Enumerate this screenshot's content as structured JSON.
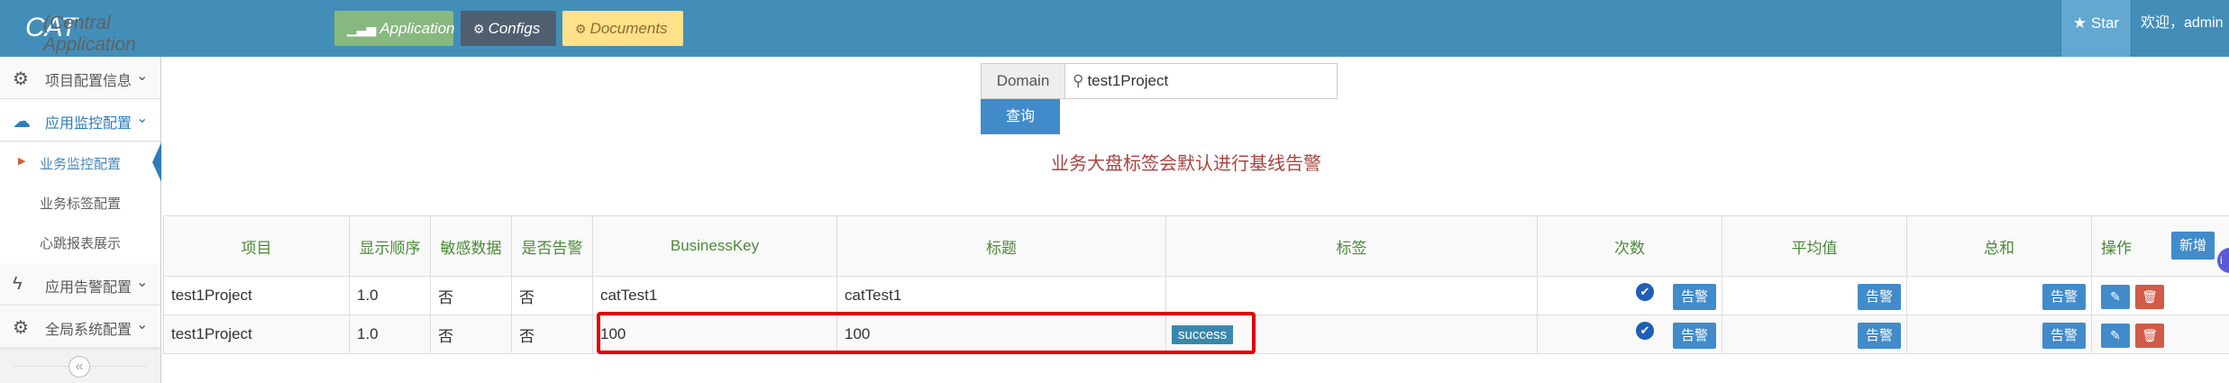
{
  "header": {
    "brand": "CAT",
    "subtitle": "(Central Application Tracking)",
    "buttons": [
      {
        "label": "Application",
        "icon": "signal-icon"
      },
      {
        "label": "Configs",
        "icon": "cogs-icon"
      },
      {
        "label": "Documents",
        "icon": "cogs-icon"
      }
    ],
    "star_label": "Star",
    "welcome": "欢迎，admin"
  },
  "sidebar": {
    "items": [
      {
        "label": "项目配置信息",
        "icon": "cogs-icon"
      },
      {
        "label": "应用监控配置",
        "icon": "cloud-icon"
      },
      {
        "label": "应用告警配置",
        "icon": "bolt-icon"
      },
      {
        "label": "全局系统配置",
        "icon": "gear-icon"
      }
    ],
    "sub_items": [
      {
        "label": "业务监控配置"
      },
      {
        "label": "业务标签配置"
      },
      {
        "label": "心跳报表展示"
      }
    ]
  },
  "search": {
    "domain_label": "Domain",
    "domain_value": "test1Project",
    "query_label": "查询"
  },
  "notice": "业务大盘标签会默认进行基线告警",
  "table": {
    "headers": [
      "项目",
      "显示顺序",
      "敏感数据",
      "是否告警",
      "BusinessKey",
      "标题",
      "标签",
      "次数",
      "平均值",
      "总和",
      "操作"
    ],
    "add_label": "新增",
    "warn_label": "告警",
    "rows": [
      {
        "project": "test1Project",
        "order": "1.0",
        "sensitive": "否",
        "alarm": "否",
        "key": "catTest1",
        "title": "catTest1",
        "tag": ""
      },
      {
        "project": "test1Project",
        "order": "1.0",
        "sensitive": "否",
        "alarm": "否",
        "key": "100",
        "title": "100",
        "tag": "success"
      }
    ]
  },
  "colors": {
    "header_bg": "#438eb9",
    "accent": "#428bca",
    "notice": "#a94442",
    "highlight": "#e00000"
  }
}
